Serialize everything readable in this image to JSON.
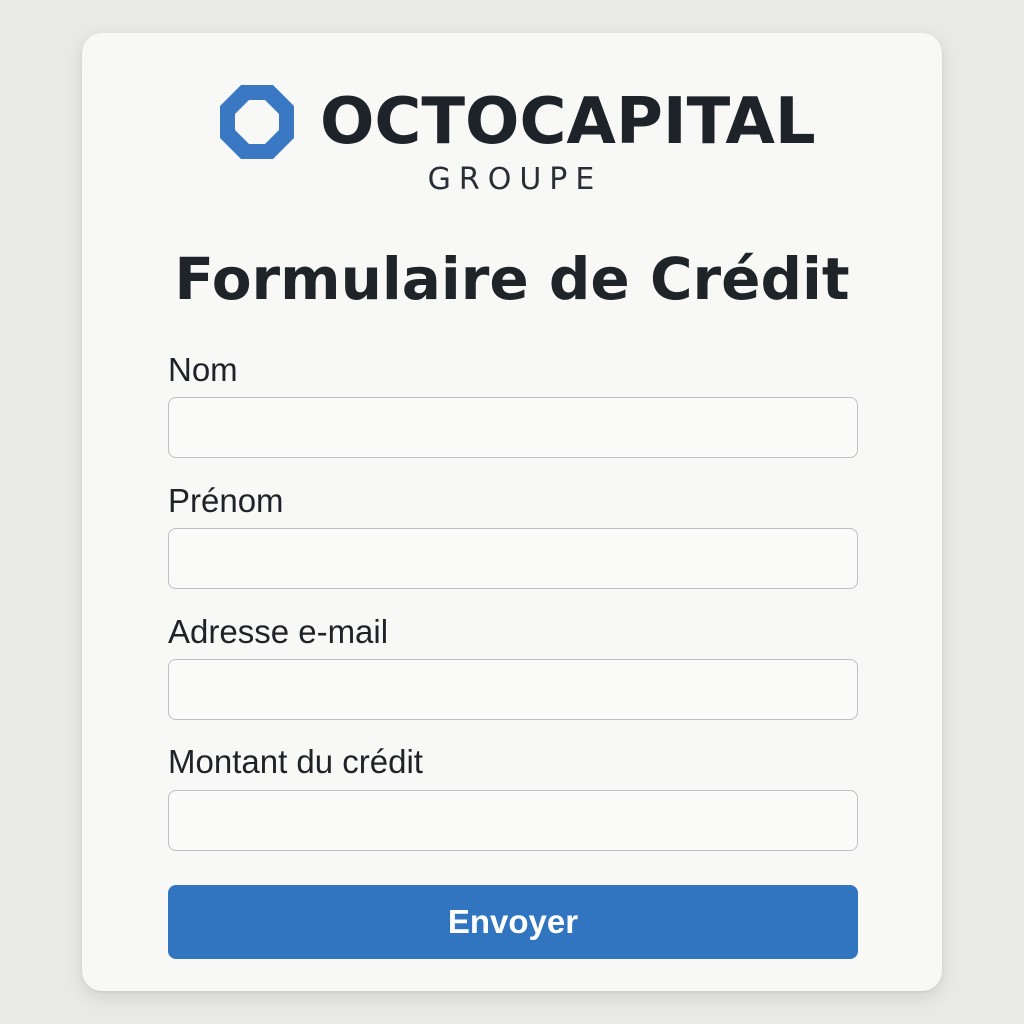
{
  "brand": {
    "name": "OCTOCAPITAL",
    "subtitle": "GROUPE",
    "logo_icon": "octagon-ring-icon",
    "accent_color": "#3a78c4"
  },
  "form": {
    "title": "Formulaire de Crédit",
    "fields": [
      {
        "label": "Nom",
        "value": "",
        "placeholder": ""
      },
      {
        "label": "Prénom",
        "value": "",
        "placeholder": ""
      },
      {
        "label": "Adresse e-mail",
        "value": "",
        "placeholder": ""
      },
      {
        "label": "Montant du crédit",
        "value": "",
        "placeholder": ""
      }
    ],
    "submit_label": "Envoyer",
    "submit_color": "#3174c0"
  }
}
